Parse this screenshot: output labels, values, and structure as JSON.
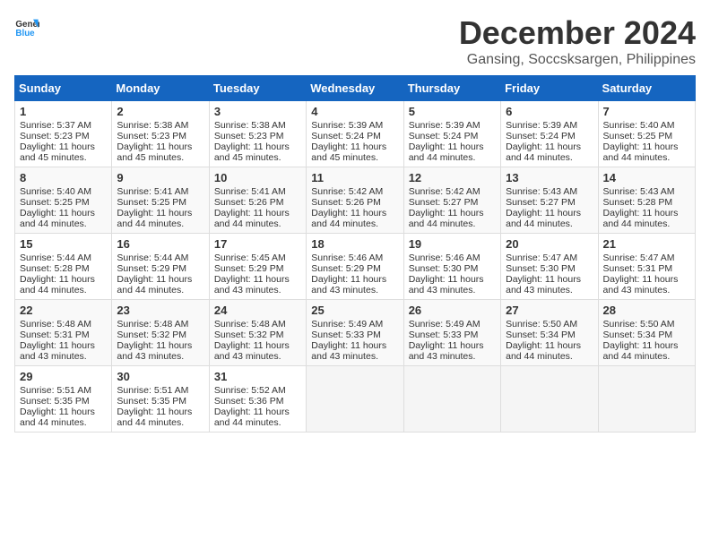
{
  "header": {
    "logo_general": "General",
    "logo_blue": "Blue",
    "title": "December 2024",
    "subtitle": "Gansing, Soccsksargen, Philippines"
  },
  "columns": [
    "Sunday",
    "Monday",
    "Tuesday",
    "Wednesday",
    "Thursday",
    "Friday",
    "Saturday"
  ],
  "weeks": [
    [
      {
        "day": "1",
        "sunrise": "5:37 AM",
        "sunset": "5:23 PM",
        "daylight": "11 hours and 45 minutes."
      },
      {
        "day": "2",
        "sunrise": "5:38 AM",
        "sunset": "5:23 PM",
        "daylight": "11 hours and 45 minutes."
      },
      {
        "day": "3",
        "sunrise": "5:38 AM",
        "sunset": "5:23 PM",
        "daylight": "11 hours and 45 minutes."
      },
      {
        "day": "4",
        "sunrise": "5:39 AM",
        "sunset": "5:24 PM",
        "daylight": "11 hours and 45 minutes."
      },
      {
        "day": "5",
        "sunrise": "5:39 AM",
        "sunset": "5:24 PM",
        "daylight": "11 hours and 44 minutes."
      },
      {
        "day": "6",
        "sunrise": "5:39 AM",
        "sunset": "5:24 PM",
        "daylight": "11 hours and 44 minutes."
      },
      {
        "day": "7",
        "sunrise": "5:40 AM",
        "sunset": "5:25 PM",
        "daylight": "11 hours and 44 minutes."
      }
    ],
    [
      {
        "day": "8",
        "sunrise": "5:40 AM",
        "sunset": "5:25 PM",
        "daylight": "11 hours and 44 minutes."
      },
      {
        "day": "9",
        "sunrise": "5:41 AM",
        "sunset": "5:25 PM",
        "daylight": "11 hours and 44 minutes."
      },
      {
        "day": "10",
        "sunrise": "5:41 AM",
        "sunset": "5:26 PM",
        "daylight": "11 hours and 44 minutes."
      },
      {
        "day": "11",
        "sunrise": "5:42 AM",
        "sunset": "5:26 PM",
        "daylight": "11 hours and 44 minutes."
      },
      {
        "day": "12",
        "sunrise": "5:42 AM",
        "sunset": "5:27 PM",
        "daylight": "11 hours and 44 minutes."
      },
      {
        "day": "13",
        "sunrise": "5:43 AM",
        "sunset": "5:27 PM",
        "daylight": "11 hours and 44 minutes."
      },
      {
        "day": "14",
        "sunrise": "5:43 AM",
        "sunset": "5:28 PM",
        "daylight": "11 hours and 44 minutes."
      }
    ],
    [
      {
        "day": "15",
        "sunrise": "5:44 AM",
        "sunset": "5:28 PM",
        "daylight": "11 hours and 44 minutes."
      },
      {
        "day": "16",
        "sunrise": "5:44 AM",
        "sunset": "5:29 PM",
        "daylight": "11 hours and 44 minutes."
      },
      {
        "day": "17",
        "sunrise": "5:45 AM",
        "sunset": "5:29 PM",
        "daylight": "11 hours and 43 minutes."
      },
      {
        "day": "18",
        "sunrise": "5:46 AM",
        "sunset": "5:29 PM",
        "daylight": "11 hours and 43 minutes."
      },
      {
        "day": "19",
        "sunrise": "5:46 AM",
        "sunset": "5:30 PM",
        "daylight": "11 hours and 43 minutes."
      },
      {
        "day": "20",
        "sunrise": "5:47 AM",
        "sunset": "5:30 PM",
        "daylight": "11 hours and 43 minutes."
      },
      {
        "day": "21",
        "sunrise": "5:47 AM",
        "sunset": "5:31 PM",
        "daylight": "11 hours and 43 minutes."
      }
    ],
    [
      {
        "day": "22",
        "sunrise": "5:48 AM",
        "sunset": "5:31 PM",
        "daylight": "11 hours and 43 minutes."
      },
      {
        "day": "23",
        "sunrise": "5:48 AM",
        "sunset": "5:32 PM",
        "daylight": "11 hours and 43 minutes."
      },
      {
        "day": "24",
        "sunrise": "5:48 AM",
        "sunset": "5:32 PM",
        "daylight": "11 hours and 43 minutes."
      },
      {
        "day": "25",
        "sunrise": "5:49 AM",
        "sunset": "5:33 PM",
        "daylight": "11 hours and 43 minutes."
      },
      {
        "day": "26",
        "sunrise": "5:49 AM",
        "sunset": "5:33 PM",
        "daylight": "11 hours and 43 minutes."
      },
      {
        "day": "27",
        "sunrise": "5:50 AM",
        "sunset": "5:34 PM",
        "daylight": "11 hours and 44 minutes."
      },
      {
        "day": "28",
        "sunrise": "5:50 AM",
        "sunset": "5:34 PM",
        "daylight": "11 hours and 44 minutes."
      }
    ],
    [
      {
        "day": "29",
        "sunrise": "5:51 AM",
        "sunset": "5:35 PM",
        "daylight": "11 hours and 44 minutes."
      },
      {
        "day": "30",
        "sunrise": "5:51 AM",
        "sunset": "5:35 PM",
        "daylight": "11 hours and 44 minutes."
      },
      {
        "day": "31",
        "sunrise": "5:52 AM",
        "sunset": "5:36 PM",
        "daylight": "11 hours and 44 minutes."
      },
      null,
      null,
      null,
      null
    ]
  ]
}
